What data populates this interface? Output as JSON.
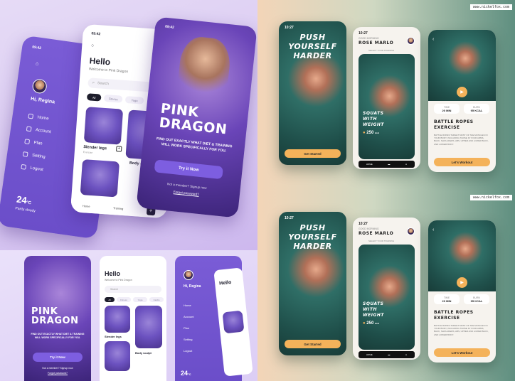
{
  "pink": {
    "status_time_1": "09:42",
    "status_time_2": "09:42",
    "greeting": "Hello",
    "welcome": "Welcome to Pink Dragon",
    "search_placeholder": "Search",
    "chips": [
      "All",
      "Fitness",
      "Yoga",
      "Cardio"
    ],
    "user_name": "Hi, Regina",
    "menu": [
      "Home",
      "Account",
      "Plan",
      "Setting",
      "Logout"
    ],
    "temp": "24",
    "temp_unit": "°C",
    "weather": "Partly cloudy",
    "card1_title": "Slender legs",
    "card1_sub": "Exercise",
    "card2_title": "Body sculpt",
    "card2_sub": "Exercise",
    "nav": [
      "Home",
      "Training"
    ],
    "brand_line1": "PINK",
    "brand_line2": "DRAGON",
    "tagline": "FIND OUT EXACTLY WHAT DIET & TRAINING WILL WORK SPECIFICALLY FOR YOU.",
    "cta": "Try it Now",
    "not_member": "Not a member? Signup now",
    "forgot": "Forgot password?"
  },
  "fitness": {
    "watermark": "www.nickelfox.com",
    "time": "10:27",
    "headline": [
      "PUSH",
      "YOURSELF",
      "HARDER"
    ],
    "get_started": "Get Started",
    "good_morning": "GOOD MORNING",
    "user": "ROSE MARLO",
    "select_training": "SELECT YOUR TRAINING",
    "card_title": [
      "SQUATS",
      "WITH",
      "WEIGHT"
    ],
    "kcal": "250",
    "kcal_unit": "kcal",
    "nav_home": "HOME",
    "stat1_label": "TIME",
    "stat1_value": "20 MIN",
    "stat2_label": "BURN",
    "stat2_value": "95 KCAL",
    "exercise_title": [
      "BATTLE ROPES",
      "EXERCISE"
    ],
    "exercise_desc": "BATTLE ROPES TARGET MOST OF THE MUSCLES IN YOUR BODY, INCLUDING THOSE IN YOUR ARMS, BACK, SHOULDERS, ABS, UPPER AND LOWER BACK, AND LOWER BODY.",
    "workout": "Let's Workout"
  },
  "colors": {
    "purple": "#7a5cd6",
    "orange": "#f4b25a",
    "teal": "#1f4f4a"
  }
}
